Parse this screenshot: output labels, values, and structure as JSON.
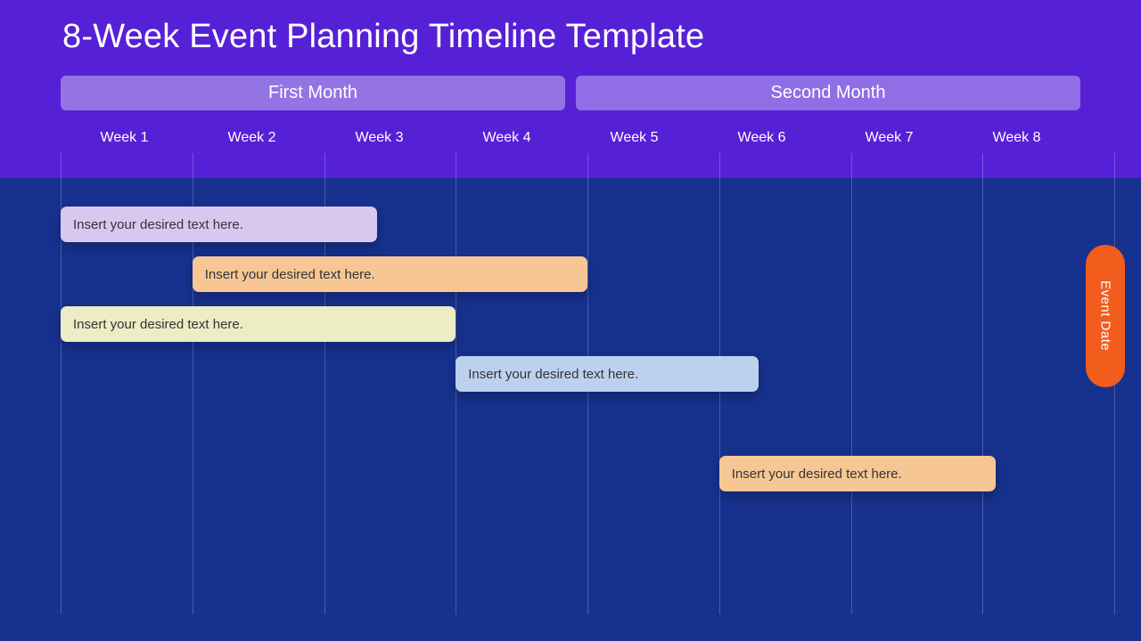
{
  "title": "8-Week Event Planning Timeline Template",
  "months": {
    "first": "First Month",
    "second": "Second Month"
  },
  "weeks": [
    "Week 1",
    "Week 2",
    "Week 3",
    "Week 4",
    "Week 5",
    "Week 6",
    "Week 7",
    "Week 8"
  ],
  "event_label": "Event Date",
  "colors": {
    "header_bg": "#5621d6",
    "body_bg": "#17318e",
    "event_pill": "#f25c1c"
  },
  "chart_data": {
    "type": "bar",
    "orientation": "gantt",
    "x_unit": "week",
    "x_range": [
      0,
      8
    ],
    "xlabel": "",
    "ylabel": "",
    "grid": true,
    "series": [
      {
        "name": "task-1",
        "label": "Insert your desired text here.",
        "start": 0.0,
        "end": 2.4,
        "row": 0,
        "color": "#d8c8f0"
      },
      {
        "name": "task-2",
        "label": "Insert your desired text here.",
        "start": 1.0,
        "end": 4.0,
        "row": 1,
        "color": "#f6c795"
      },
      {
        "name": "task-3",
        "label": "Insert your desired text here.",
        "start": 0.0,
        "end": 3.0,
        "row": 2,
        "color": "#ecedc5"
      },
      {
        "name": "task-4",
        "label": "Insert your desired text here.",
        "start": 3.0,
        "end": 5.3,
        "row": 3,
        "color": "#bcd1ee"
      },
      {
        "name": "task-5",
        "label": "Insert your desired text here.",
        "start": 5.0,
        "end": 7.1,
        "row": 5,
        "color": "#f6c795"
      }
    ],
    "categories": [
      "Week 1",
      "Week 2",
      "Week 3",
      "Week 4",
      "Week 5",
      "Week 6",
      "Week 7",
      "Week 8"
    ]
  }
}
